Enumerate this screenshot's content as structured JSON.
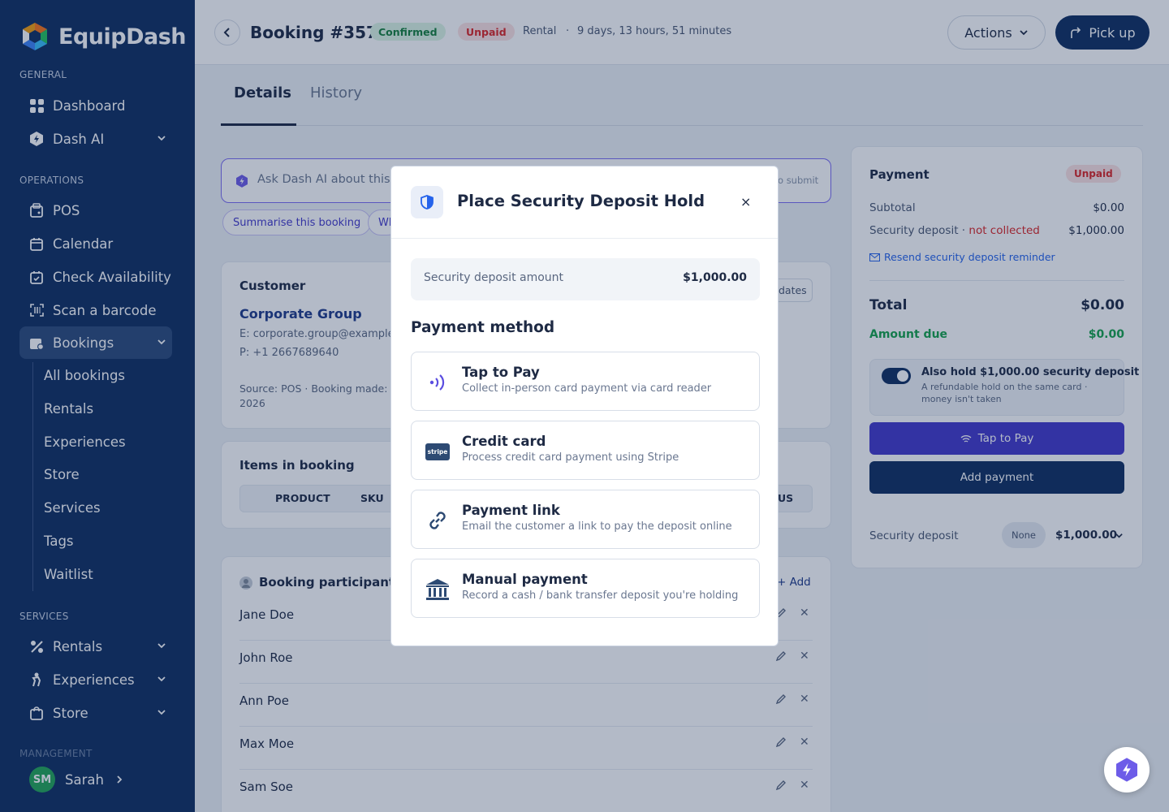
{
  "app": {
    "name": "EquipDash"
  },
  "sidebar": {
    "sections": [
      "GENERAL",
      "OPERATIONS",
      "SERVICES",
      "MANAGEMENT"
    ],
    "general": [
      {
        "label": "Dashboard",
        "icon": "grid-icon"
      },
      {
        "label": "Dash AI",
        "icon": "dash-ai-icon"
      }
    ],
    "operations": [
      {
        "label": "POS",
        "icon": "pos-icon"
      },
      {
        "label": "Calendar",
        "icon": "calendar-icon"
      },
      {
        "label": "Check Availability",
        "icon": "calendar-check-icon"
      },
      {
        "label": "Scan a barcode",
        "icon": "barcode-icon"
      },
      {
        "label": "Bookings",
        "icon": "bookings-icon"
      }
    ],
    "bookings_sub": [
      "All bookings",
      "Rentals",
      "Experiences",
      "Store",
      "Services",
      "Tags",
      "Waitlist"
    ],
    "services": [
      {
        "label": "Rentals",
        "icon": "rentals-icon"
      },
      {
        "label": "Experiences",
        "icon": "experiences-icon"
      },
      {
        "label": "Store",
        "icon": "store-icon"
      }
    ],
    "user": {
      "initials": "SM",
      "name": "Sarah"
    }
  },
  "header": {
    "title": "Booking #357",
    "status": "Confirmed",
    "payment_status": "Unpaid",
    "type": "Rental",
    "sep": "·",
    "duration": "9 days, 13 hours, 51 minutes",
    "actions_label": "Actions",
    "pickup_label": "Pick up"
  },
  "tabs": [
    "Details",
    "History"
  ],
  "ai": {
    "placeholder": "Ask Dash AI about this b",
    "hint": "o submit",
    "chips": [
      "Summarise this booking",
      "Wh"
    ]
  },
  "customer": {
    "heading": "Customer",
    "name": "Corporate Group",
    "email": "E: corporate.group@example",
    "phone": "P: +1 2667689640",
    "source": "Source: POS  ·  Booking made: 9",
    "year": "2026",
    "updates_label": "dates"
  },
  "items": {
    "heading": "Items in booking",
    "columns": [
      "PRODUCT",
      "SKU"
    ],
    "trailing_col": "US"
  },
  "participants": {
    "heading": "Booking participants",
    "add_label": "+ Add",
    "names": [
      "Jane Doe",
      "John Roe",
      "Ann Poe",
      "Max Moe",
      "Sam Soe"
    ]
  },
  "payment": {
    "heading": "Payment",
    "status": "Unpaid",
    "subtotal_label": "Subtotal",
    "subtotal": "$0.00",
    "deposit_label": "Security deposit · ",
    "deposit_state": "not collected",
    "deposit_value": "$1,000.00",
    "resend_label": "Resend security deposit reminder",
    "total_label": "Total",
    "total": "$0.00",
    "due_label": "Amount due",
    "due": "$0.00",
    "hold_title": "Also hold $1,000.00 security deposit",
    "hold_desc1": "A refundable hold on the same card ·",
    "hold_desc2": "money isn't taken",
    "tap_label": "Tap to Pay",
    "add_label": "Add payment",
    "footer_label": "Security deposit",
    "footer_badge": "None",
    "footer_value": "$1,000.00"
  },
  "modal": {
    "title": "Place Security Deposit Hold",
    "close": "×",
    "amount_label": "Security deposit amount",
    "amount": "$1,000.00",
    "method_label": "Payment method",
    "options": [
      {
        "title": "Tap to Pay",
        "desc": "Collect in-person card payment via card reader",
        "icon": "contactless-icon"
      },
      {
        "title": "Credit card",
        "desc": "Process credit card payment using Stripe",
        "icon": "stripe-icon",
        "icon_text": "stripe"
      },
      {
        "title": "Payment link",
        "desc": "Email the customer a link to pay the deposit online",
        "icon": "link-icon"
      },
      {
        "title": "Manual payment",
        "desc": "Record a cash / bank transfer deposit you're holding",
        "icon": "bank-icon"
      }
    ]
  },
  "colors": {
    "navy": "#0f2e61",
    "accent": "#4338ca",
    "green": "#16a34a",
    "red": "#dc2626"
  }
}
